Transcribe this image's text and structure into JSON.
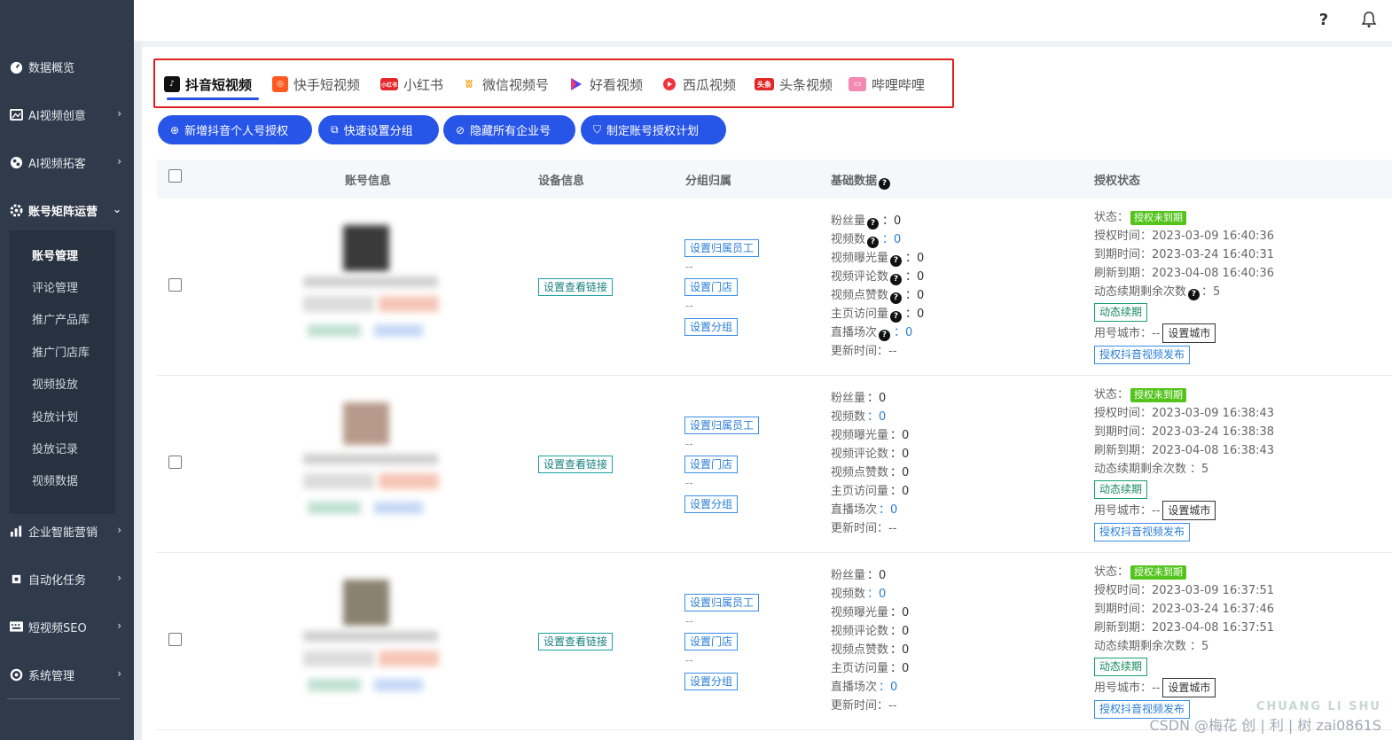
{
  "sidebar": {
    "items": [
      {
        "label": "数据概览",
        "icon": "dashboard-icon"
      },
      {
        "label": "AI视频创意",
        "icon": "image-icon"
      },
      {
        "label": "AI视频拓客",
        "icon": "globe-icon"
      },
      {
        "label": "账号矩阵运营",
        "icon": "gear-icon"
      },
      {
        "label": "企业智能营销",
        "icon": "bar-chart-icon"
      },
      {
        "label": "自动化任务",
        "icon": "cpu-icon"
      },
      {
        "label": "短视频SEO",
        "icon": "keyboard-icon"
      },
      {
        "label": "系统管理",
        "icon": "settings-icon"
      }
    ],
    "submenu": [
      "账号管理",
      "评论管理",
      "推广产品库",
      "推广门店库",
      "视频投放",
      "投放计划",
      "投放记录",
      "视频数据"
    ]
  },
  "topbar": {
    "help_icon": "?",
    "bell_icon": "bell"
  },
  "tabs": [
    {
      "label": "抖音短视频",
      "icon": "douyin-icon",
      "color": "#111111"
    },
    {
      "label": "快手短视频",
      "icon": "kuaishou-icon",
      "color": "#ff5a1f"
    },
    {
      "label": "小红书",
      "icon": "xiaohongshu-icon",
      "color": "#e4262b",
      "badge": "小红书"
    },
    {
      "label": "微信视频号",
      "icon": "wechat-channels-icon",
      "color": "#f5a623"
    },
    {
      "label": "好看视频",
      "icon": "haokan-icon",
      "color": "#5b3df5"
    },
    {
      "label": "西瓜视频",
      "icon": "xigua-icon",
      "color": "#f0323c"
    },
    {
      "label": "头条视频",
      "icon": "toutiao-icon",
      "color": "#e02828",
      "badge": "头条"
    },
    {
      "label": "哔哩哔哩",
      "icon": "bilibili-icon",
      "color": "#f28bb0"
    }
  ],
  "actions": [
    {
      "label": "新增抖音个人号授权",
      "icon": "⊕"
    },
    {
      "label": "快速设置分组",
      "icon": "⧉"
    },
    {
      "label": "隐藏所有企业号",
      "icon": "⊘"
    },
    {
      "label": "制定账号授权计划",
      "icon": "⛉"
    }
  ],
  "table": {
    "headers": [
      "账号信息",
      "设备信息",
      "分组归属",
      "基础数据",
      "授权状态"
    ],
    "rows": [
      {
        "device_link": "设置查看链接",
        "group": {
          "employee": "设置归属员工",
          "store": "设置门店",
          "group": "设置分组",
          "dash1": "--",
          "dash2": "--"
        },
        "stats": {
          "fans": "粉丝量",
          "fans_v": "：0",
          "views": "视频数",
          "views_v": "：0",
          "exposure": "视频曝光量",
          "exposure_v": "：0",
          "comments": "视频评论数",
          "comments_v": "：0",
          "likes": "视频点赞数",
          "likes_v": "：0",
          "home": "主页访问量",
          "home_v": "：0",
          "live": "直播场次",
          "live_v": "：0",
          "update": "更新时间：--"
        },
        "auth": {
          "status_label": "状态：",
          "status": "授权未到期",
          "auth_time": "授权时间：2023-03-09 16:40:36",
          "expire": "到期时间：2023-03-24 16:40:31",
          "refresh": "刷新到期：2023-04-08 16:40:36",
          "renew": "动态续期剩余次数",
          "renew_v": "：5",
          "renew_btn": "动态续期",
          "city": "用号城市：--",
          "city_btn": "设置城市",
          "publish_btn": "授权抖音视频发布"
        }
      },
      {
        "device_link": "设置查看链接",
        "group": {
          "employee": "设置归属员工",
          "store": "设置门店",
          "group": "设置分组",
          "dash1": "--",
          "dash2": "--"
        },
        "stats": {
          "fans": "粉丝量",
          "fans_v": "：0",
          "views": "视频数",
          "views_v": "：0",
          "exposure": "视频曝光量",
          "exposure_v": "：0",
          "comments": "视频评论数",
          "comments_v": "：0",
          "likes": "视频点赞数",
          "likes_v": "：0",
          "home": "主页访问量",
          "home_v": "：0",
          "live": "直播场次",
          "live_v": "：0",
          "update": "更新时间：--"
        },
        "auth": {
          "status_label": "状态：",
          "status": "授权未到期",
          "auth_time": "授权时间：2023-03-09 16:38:43",
          "expire": "到期时间：2023-03-24 16:38:38",
          "refresh": "刷新到期：2023-04-08 16:38:43",
          "renew": "动态续期剩余次数",
          "renew_v": "：5",
          "renew_btn": "动态续期",
          "city": "用号城市：--",
          "city_btn": "设置城市",
          "publish_btn": "授权抖音视频发布"
        }
      },
      {
        "device_link": "设置查看链接",
        "group": {
          "employee": "设置归属员工",
          "store": "设置门店",
          "group": "设置分组",
          "dash1": "--",
          "dash2": "--"
        },
        "stats": {
          "fans": "粉丝量",
          "fans_v": "：0",
          "views": "视频数",
          "views_v": "：0",
          "exposure": "视频曝光量",
          "exposure_v": "：0",
          "comments": "视频评论数",
          "comments_v": "：0",
          "likes": "视频点赞数",
          "likes_v": "：0",
          "home": "主页访问量",
          "home_v": "：0",
          "live": "直播场次",
          "live_v": "：0",
          "update": "更新时间：--"
        },
        "auth": {
          "status_label": "状态：",
          "status": "授权未到期",
          "auth_time": "授权时间：2023-03-09 16:37:51",
          "expire": "到期时间：2023-03-24 16:37:46",
          "refresh": "刷新到期：2023-04-08 16:37:51",
          "renew": "动态续期剩余次数",
          "renew_v": "：5",
          "renew_btn": "动态续期",
          "city": "用号城市：--",
          "city_btn": "设置城市",
          "publish_btn": "授权抖音视频发布"
        }
      }
    ]
  },
  "watermark": {
    "line1": "CHUANG LI SHU",
    "line2": "CSDN @梅花 创 | 利 | 树 zai0861S"
  }
}
